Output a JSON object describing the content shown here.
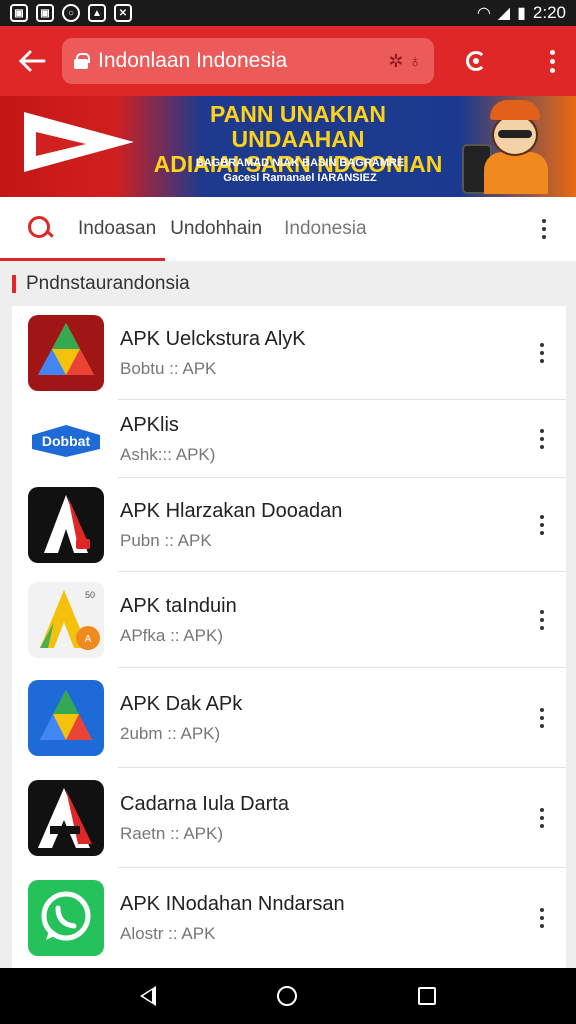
{
  "status_bar": {
    "time": "2:20",
    "left_icons": [
      "notification-icon",
      "notification-icon",
      "notification-icon",
      "image-icon",
      "close-icon"
    ],
    "right_icons": [
      "wifi-icon",
      "signal-icon",
      "battery-icon"
    ]
  },
  "toolbar": {
    "url": "Indonlaan Indonesia",
    "url_extra": "✲ ♁",
    "back_icon": "back-arrow-icon",
    "refresh_icon": "refresh-icon",
    "menu_icon": "more-vert-icon"
  },
  "banner": {
    "headline_line1": "PANN UNAKIAN UNDAAHAN",
    "headline_line2": "ADIAIAI SARN NDOONIAN",
    "sub_line1": "BAGBRAMAD NIAK BASIN BAGRAMRE",
    "sub_line2": "Gacesl Ramanael IARANSIEZ"
  },
  "search_strip": {
    "tab1": "Indoasan",
    "tab2": "Undohhain",
    "tab3": "Indonesia"
  },
  "section": {
    "title": "Pndnstaurandonsia"
  },
  "apps": [
    {
      "title": "APK Uelckstura AlyK",
      "subtitle": "Bobtu :: APK"
    },
    {
      "title": "APKlis",
      "subtitle": "Ashk::: APK)"
    },
    {
      "title": "APK Hlarzakan Dooadan",
      "subtitle": "Pubn :: APK"
    },
    {
      "title": "APK taInduin",
      "subtitle": "APfka :: APK)"
    },
    {
      "title": "APK Dak APk",
      "subtitle": "2ubm :: APK)"
    },
    {
      "title": "Cadarna Iula Darta",
      "subtitle": "Raetn :: APK)"
    },
    {
      "title": "APK INodahan Nndarsan",
      "subtitle": "Alostr :: APK"
    }
  ],
  "app_icon_texts": {
    "dobbat": "Dobbat",
    "badge_num": "50",
    "badge_small": "A"
  },
  "colors": {
    "primary": "#e02727",
    "banner_blue": "#1b3a8f",
    "banner_yellow": "#ffd21a"
  }
}
